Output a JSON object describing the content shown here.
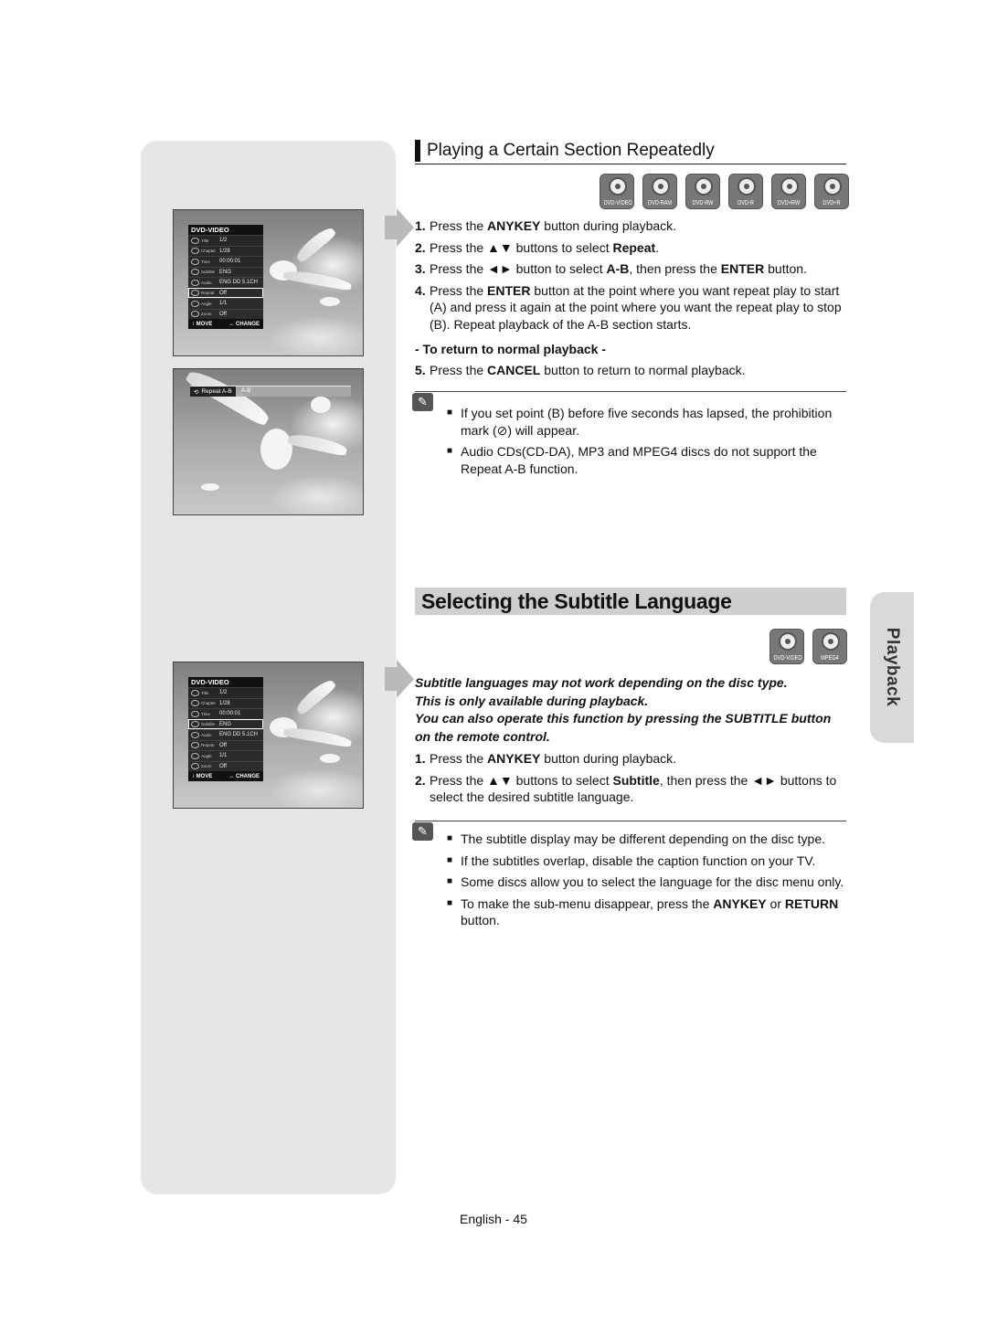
{
  "page": {
    "footer": "English - 45",
    "side_tab": "Playback"
  },
  "section1": {
    "title": "Playing a Certain Section Repeatedly",
    "discs": [
      "DVD-VIDEO",
      "DVD-RAM",
      "DVD-RW",
      "DVD-R",
      "DVD+RW",
      "DVD+R"
    ],
    "steps": [
      {
        "num": "1.",
        "parts": [
          [
            "Press the ",
            false
          ],
          [
            "ANYKEY",
            true
          ],
          [
            " button during playback.",
            false
          ]
        ]
      },
      {
        "num": "2.",
        "parts": [
          [
            "Press the ▲▼ buttons to select ",
            false
          ],
          [
            "Repeat",
            true
          ],
          [
            ".",
            false
          ]
        ]
      },
      {
        "num": "3.",
        "parts": [
          [
            "Press the ◄► button to select ",
            false
          ],
          [
            "A-B",
            true
          ],
          [
            ", then press the ",
            false
          ],
          [
            "ENTER",
            true
          ],
          [
            " button.",
            false
          ]
        ]
      },
      {
        "num": "4.",
        "parts": [
          [
            "Press the ",
            false
          ],
          [
            "ENTER",
            true
          ],
          [
            " button at the point where you want repeat play to start (A) and press it again at the point where you want the repeat play to stop (B). Repeat playback of the A-B section starts.",
            false
          ]
        ]
      }
    ],
    "return_heading": "- To return to normal playback -",
    "step5": {
      "num": "5.",
      "parts": [
        [
          "Press the ",
          false
        ],
        [
          "CANCEL",
          true
        ],
        [
          " button to return to normal playback.",
          false
        ]
      ]
    },
    "notes": [
      "If you set point (B) before five seconds has lapsed, the prohibition mark (⊘) will appear.",
      "Audio CDs(CD-DA), MP3 and MPEG4 discs do not support the Repeat A-B function."
    ],
    "osd": {
      "header": "DVD-VIDEO",
      "rows": [
        {
          "key": "Title",
          "value": "1/2"
        },
        {
          "key": "Chapter",
          "value": "1/28"
        },
        {
          "key": "Time",
          "value": "00:00:01"
        },
        {
          "key": "Subtitle",
          "value": "ENG"
        },
        {
          "key": "Audio",
          "value": "ENG DD 5.1CH"
        },
        {
          "key": "Repeat",
          "value": "Off"
        },
        {
          "key": "Angle",
          "value": "1/1"
        },
        {
          "key": "Zoom",
          "value": "Off"
        }
      ],
      "selected": "Repeat",
      "footer_move": "↕ MOVE",
      "footer_change": "↔ CHANGE"
    },
    "repeat_bar": {
      "label": "Repeat A-B",
      "value": "A-B"
    }
  },
  "section2": {
    "title": "Selecting the Subtitle Language",
    "discs": [
      "DVD-VIDEO",
      "MPEG4"
    ],
    "intro": [
      "Subtitle languages may not work depending on the disc type.",
      "This is only available during playback.",
      "You can also operate this function by pressing the SUBTITLE button on the remote control."
    ],
    "steps": [
      {
        "num": "1.",
        "parts": [
          [
            "Press the ",
            false
          ],
          [
            "ANYKEY",
            true
          ],
          [
            " button during playback.",
            false
          ]
        ]
      },
      {
        "num": "2.",
        "parts": [
          [
            "Press the ▲▼ buttons to select ",
            false
          ],
          [
            "Subtitle",
            true
          ],
          [
            ", then press the ◄► buttons to select the desired subtitle language.",
            false
          ]
        ]
      }
    ],
    "notes": [
      [
        [
          "The subtitle display may be different depending on the disc type.",
          false
        ]
      ],
      [
        [
          "If the subtitles overlap, disable the caption function on your TV.",
          false
        ]
      ],
      [
        [
          "Some discs allow you to select the language for the disc menu only.",
          false
        ]
      ],
      [
        [
          "To make the sub-menu disappear, press the ",
          false
        ],
        [
          "ANYKEY",
          true
        ],
        [
          " or ",
          false
        ],
        [
          "RETURN",
          true
        ],
        [
          " button.",
          false
        ]
      ]
    ],
    "osd": {
      "header": "DVD-VIDEO",
      "rows": [
        {
          "key": "Title",
          "value": "1/2"
        },
        {
          "key": "Chapter",
          "value": "1/28"
        },
        {
          "key": "Time",
          "value": "00:00:01"
        },
        {
          "key": "Subtitle",
          "value": "ENG"
        },
        {
          "key": "Audio",
          "value": "ENG DD 5.1CH"
        },
        {
          "key": "Repeat",
          "value": "Off"
        },
        {
          "key": "Angle",
          "value": "1/1"
        },
        {
          "key": "Zoom",
          "value": "Off"
        }
      ],
      "selected": "Subtitle",
      "footer_move": "↕ MOVE",
      "footer_change": "↔ CHANGE"
    }
  }
}
